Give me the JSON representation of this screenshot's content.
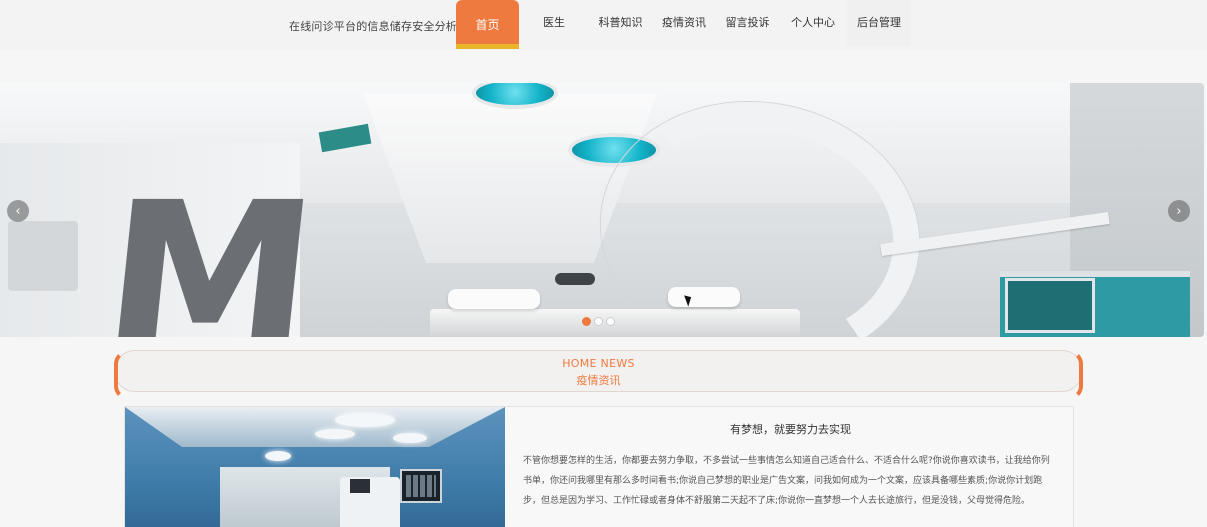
{
  "header": {
    "site_title": "在线问诊平台的信息储存安全分析",
    "nav": [
      {
        "label": "首页",
        "active": true
      },
      {
        "label": "医生"
      },
      {
        "label": "科普知识"
      },
      {
        "label": "疫情资讯"
      },
      {
        "label": "留言投诉"
      },
      {
        "label": "个人中心"
      },
      {
        "label": "后台管理"
      }
    ]
  },
  "banner": {
    "prev_icon": "chevron-left-icon",
    "next_icon": "chevron-right-icon",
    "prev_glyph": "‹",
    "next_glyph": "›",
    "dots": 3,
    "active_dot": 1,
    "letter": "M"
  },
  "section": {
    "title_en": "HOME NEWS",
    "title_cn": "疫情资讯"
  },
  "news": {
    "title": "有梦想，就要努力去实现",
    "body": "不管你想要怎样的生活，你都要去努力争取，不多尝试一些事情怎么知道自己适合什么、不适合什么呢?你说你喜欢读书，让我给你列书单，你还问我哪里有那么多时间看书;你说自己梦想的职业是广告文案，问我如何成为一个文案，应该具备哪些素质;你说你计划跑步，但总是因为学习、工作忙碌或者身体不舒服第二天起不了床;你说你一直梦想一个人去长途旅行，但是没钱，父母觉得危险。"
  },
  "colors": {
    "accent": "#ee7a40",
    "accent_underline": "#e8b52b",
    "teal": "#13b3c9"
  }
}
